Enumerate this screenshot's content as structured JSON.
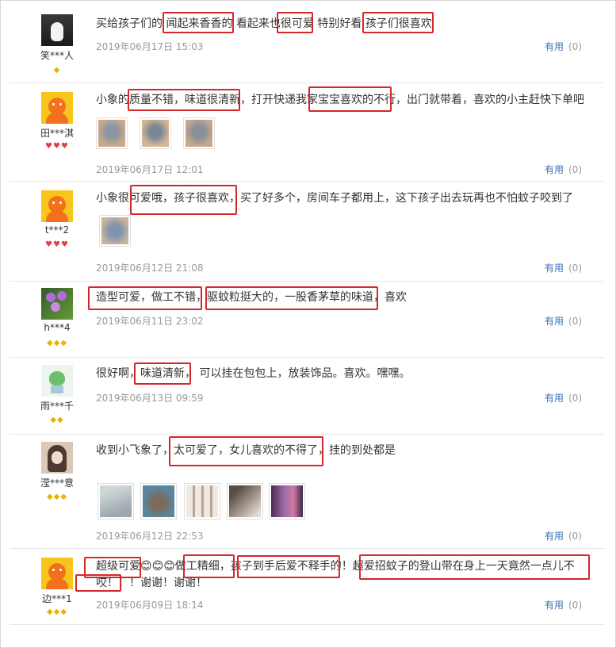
{
  "useful_label": "有用",
  "reviews": [
    {
      "user": "笑***人",
      "badges": "◆",
      "text": "买给孩子们的 闻起来香香的 看起来也很可爱 特别好看 孩子们很喜欢",
      "date": "2019年06月17日 15:03",
      "useful_count": "(0)"
    },
    {
      "user": "田***淇",
      "badges": "♥♥♥",
      "text": "小象的质量不错，味道很清新，打开快递我家宝宝喜欢的不行，出门就带着，喜欢的小主赶快下单吧",
      "date": "2019年06月17日 12:01",
      "useful_count": "(0)",
      "photos": [
        "elephant-photo-1",
        "elephant-photo-2",
        "elephant-photo-3"
      ]
    },
    {
      "user": "t***2",
      "badges": "♥♥♥",
      "text": "小象很可爱哦，孩子很喜欢，买了好多个，房间车子都用上，这下孩子出去玩再也不怕蚊子咬到了",
      "date": "2019年06月12日 21:08",
      "useful_count": "(0)",
      "photos": [
        "elephant-photo-4"
      ]
    },
    {
      "user": "h***4",
      "badges": "◆◆◆",
      "text": "造型可爱，做工不错，驱蚊粒挺大的，一股香茅草的味道，喜欢",
      "date": "2019年06月11日 23:02",
      "useful_count": "(0)"
    },
    {
      "user": "雨***千",
      "badges": "◆◆",
      "text": "很好啊，味道清新， 可以挂在包包上，放装饰品。喜欢。嘿嘿。",
      "date": "2019年06月13日 09:59",
      "useful_count": "(0)"
    },
    {
      "user": "滢***意",
      "badges": "◆◆◆",
      "text": "收到小飞象了，太可爱了，女儿喜欢的不得了，挂的到处都是",
      "date": "2019年06月12日 22:53",
      "useful_count": "(0)",
      "photos": [
        "product-photo-1",
        "product-photo-2",
        "product-photo-3",
        "product-photo-4",
        "product-photo-5"
      ]
    },
    {
      "user": "边***1",
      "badges": "◆◆◆",
      "text_line1": "超级可爱😊😊😊做工精细，孩子到手后爱不释手的！超爱招蚊子的登山带在身上一天竟然一点儿不",
      "text_line2": "咬！！！谢谢！谢谢！",
      "date": "2019年06月09日 18:14",
      "useful_count": "(0)"
    }
  ]
}
